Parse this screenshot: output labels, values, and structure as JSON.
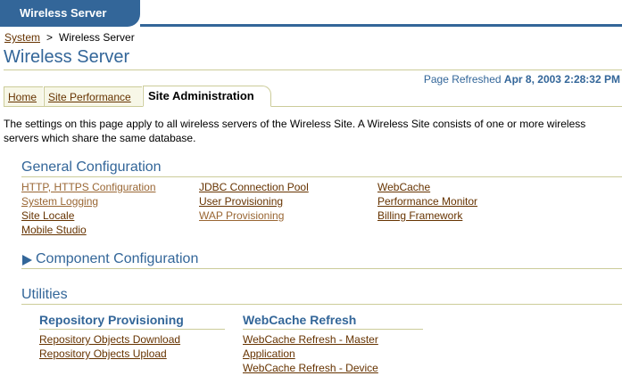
{
  "header": {
    "app_title": "Wireless Server"
  },
  "breadcrumb": {
    "parent": "System",
    "separator": ">",
    "current": "Wireless Server"
  },
  "page": {
    "title": "Wireless Server",
    "refreshed_label": "Page Refreshed",
    "refreshed_value": "Apr 8, 2003 2:28:32 PM"
  },
  "tabs": [
    {
      "label": "Home"
    },
    {
      "label": "Site Performance"
    },
    {
      "label": "Site Administration"
    }
  ],
  "description": "The settings on this page apply to all wireless servers of the Wireless Site. A Wireless Site consists of one or more wireless servers which share the same database.",
  "general_config": {
    "title": "General Configuration",
    "links": [
      "HTTP, HTTPS Configuration",
      "System Logging",
      "Site Locale",
      "Mobile Studio",
      "JDBC Connection Pool",
      "User Provisioning",
      "WAP Provisioning",
      "WebCache",
      "Performance Monitor",
      "Billing Framework"
    ]
  },
  "component_config": {
    "title": "Component Configuration"
  },
  "utilities": {
    "title": "Utilities",
    "repository": {
      "title": "Repository Provisioning",
      "links": [
        "Repository Objects Download",
        "Repository Objects Upload"
      ]
    },
    "webcache": {
      "title": "WebCache Refresh",
      "links": [
        "WebCache Refresh - Master",
        "Application",
        "WebCache Refresh - Device"
      ]
    }
  },
  "colors": {
    "brand": "#336699",
    "link": "#663300",
    "visited_link": "#996633",
    "rule": "#cccc99"
  }
}
